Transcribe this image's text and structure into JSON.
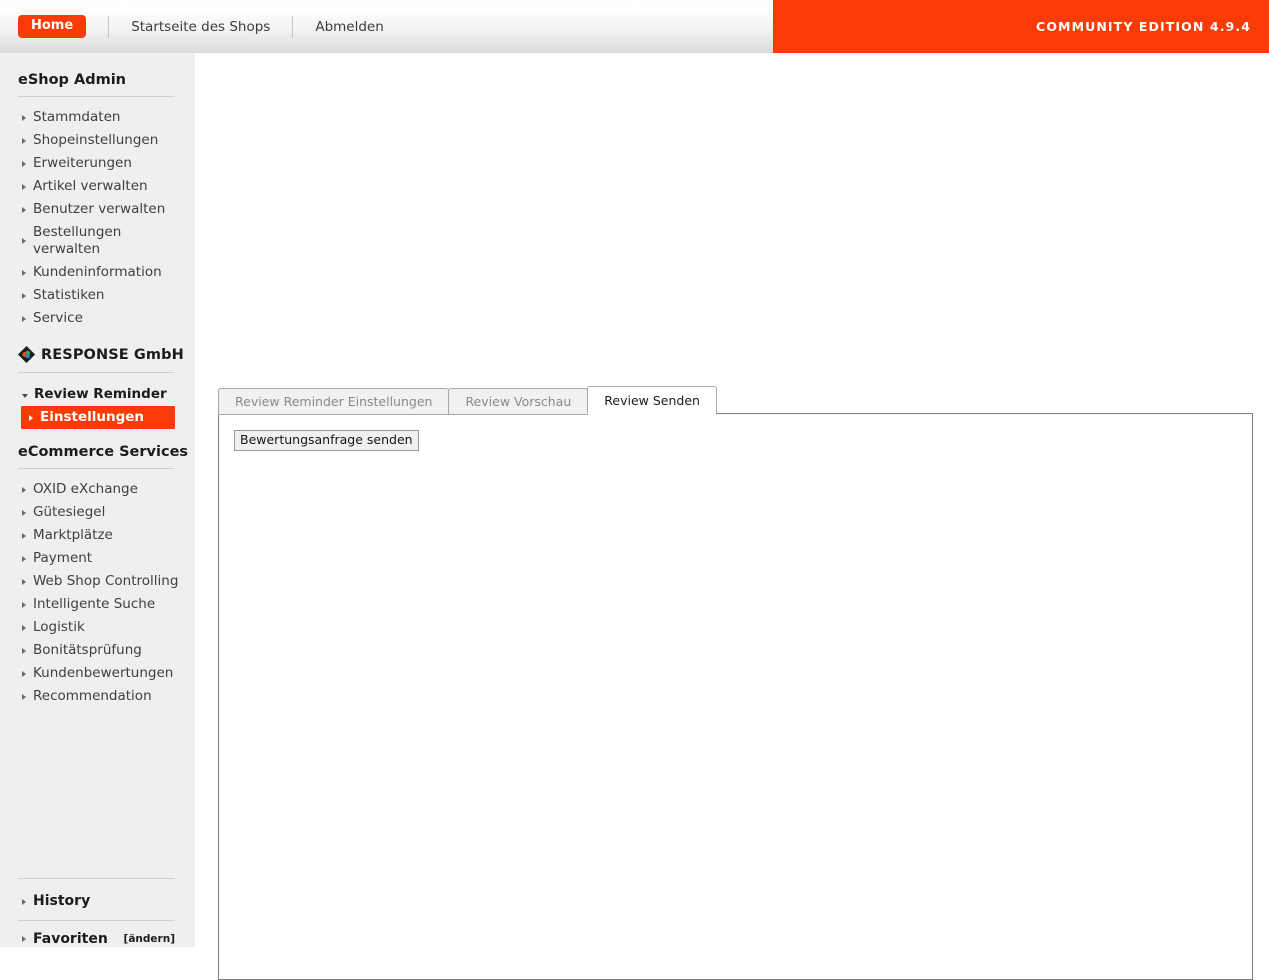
{
  "header": {
    "home_label": "Home",
    "shop_front_label": "Startseite des Shops",
    "logout_label": "Abmelden",
    "edition_label": "COMMUNITY EDITION 4.9.4",
    "accent_color": "#fb3b05"
  },
  "sidebar": {
    "admin_title": "eShop Admin",
    "admin_items": [
      {
        "label": "Stammdaten"
      },
      {
        "label": "Shopeinstellungen"
      },
      {
        "label": "Erweiterungen"
      },
      {
        "label": "Artikel verwalten"
      },
      {
        "label": "Benutzer verwalten"
      },
      {
        "label": "Bestellungen verwalten"
      },
      {
        "label": "Kundeninformation"
      },
      {
        "label": "Statistiken"
      },
      {
        "label": "Service"
      }
    ],
    "brand_name": "RESPONSE GmbH",
    "brand_icon": "diamond-logo-icon",
    "review_reminder_label": "Review Reminder",
    "einstellungen_label": "Einstellungen",
    "ecommerce_title": "eCommerce Services",
    "ecommerce_items": [
      {
        "label": "OXID eXchange"
      },
      {
        "label": "Gütesiegel"
      },
      {
        "label": "Marktplätze"
      },
      {
        "label": "Payment"
      },
      {
        "label": "Web Shop Controlling"
      },
      {
        "label": "Intelligente Suche"
      },
      {
        "label": "Logistik"
      },
      {
        "label": "Bonitätsprüfung"
      },
      {
        "label": "Kundenbewertungen"
      },
      {
        "label": "Recommendation"
      }
    ],
    "history_label": "History",
    "favorites_label": "Favoriten",
    "favorites_change_label": "[ändern]"
  },
  "main": {
    "tabs": [
      {
        "label": "Review Reminder Einstellungen",
        "active": false
      },
      {
        "label": "Review Vorschau",
        "active": false
      },
      {
        "label": "Review Senden",
        "active": true
      }
    ],
    "send_button_label": "Bewertungsanfrage senden"
  }
}
